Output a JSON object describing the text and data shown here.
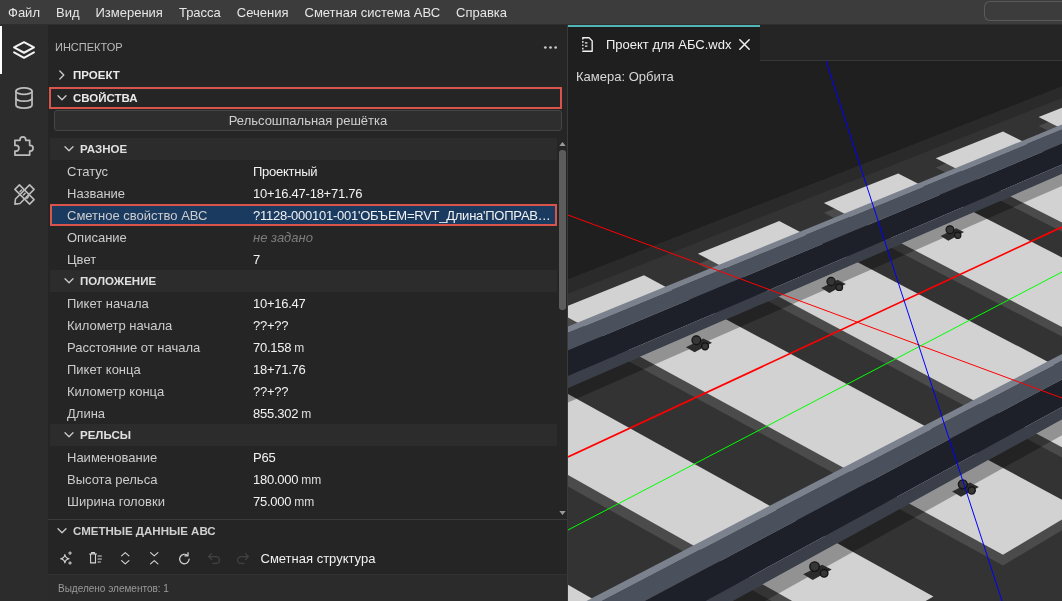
{
  "menu": [
    "Файл",
    "Вид",
    "Измерения",
    "Трасса",
    "Сечения",
    "Сметная система АВС",
    "Справка"
  ],
  "activity_bar": [
    {
      "selected": true
    },
    {
      "selected": false
    },
    {
      "selected": false
    },
    {
      "selected": false
    }
  ],
  "inspector": {
    "title": "ИНСПЕКТОР",
    "sections": [
      {
        "title": "ПРОЕКТ",
        "expanded": false,
        "highlighted": false
      },
      {
        "title": "СВОЙСТВА",
        "expanded": true,
        "highlighted": true,
        "element_type": "Рельсошпальная решётка",
        "property_groups": [
          {
            "title": "РАЗНОЕ",
            "expanded": true,
            "rows": [
              {
                "label": "Статус",
                "value": "Проектный",
                "selected": false,
                "highlighted": false
              },
              {
                "label": "Название",
                "value": "10+16.47-18+71.76",
                "selected": false,
                "highlighted": false
              },
              {
                "label": "Сметное свойство АВС",
                "value": "?1128-000101-001'ОБЪЕМ=RVT_Длина'ПОПРАВ…",
                "selected": true,
                "highlighted": true
              },
              {
                "label": "Описание",
                "placeholder": "не задано",
                "selected": false,
                "highlighted": false
              },
              {
                "label": "Цвет",
                "value": "7",
                "selected": false,
                "highlighted": false
              }
            ]
          },
          {
            "title": "ПОЛОЖЕНИЕ",
            "expanded": true,
            "rows": [
              {
                "label": "Пикет начала",
                "value": "10+16.47",
                "selected": false,
                "highlighted": false
              },
              {
                "label": "Километр начала",
                "value": "??+??",
                "selected": false,
                "highlighted": false
              },
              {
                "label": "Расстояние от начала",
                "value": "70.158",
                "unit": "m",
                "selected": false,
                "highlighted": false
              },
              {
                "label": "Пикет конца",
                "value": "18+71.76",
                "selected": false,
                "highlighted": false
              },
              {
                "label": "Километр конца",
                "value": "??+??",
                "selected": false,
                "highlighted": false
              },
              {
                "label": "Длина",
                "value": "855.302",
                "unit": "m",
                "selected": false,
                "highlighted": false
              }
            ]
          },
          {
            "title": "РЕЛЬСЫ",
            "expanded": true,
            "rows": [
              {
                "label": "Наименование",
                "value": "Р65",
                "selected": false,
                "highlighted": false
              },
              {
                "label": "Высота рельса",
                "value": "180.000",
                "unit": "mm",
                "selected": false,
                "highlighted": false
              },
              {
                "label": "Ширина головки",
                "value": "75.000",
                "unit": "mm",
                "selected": false,
                "highlighted": false
              }
            ]
          }
        ]
      }
    ],
    "estimate_panel": {
      "title": "СМЕТНЫЕ ДАННЫЕ АВС",
      "expanded": true,
      "tools": [
        {
          "disabled": false
        },
        {
          "disabled": false
        },
        {
          "disabled": false
        },
        {
          "disabled": false
        },
        {
          "disabled": false
        },
        {
          "disabled": true
        },
        {
          "disabled": true
        }
      ],
      "structure_title": "Сметная структура"
    },
    "status": "Выделено элементов: 1"
  },
  "editor": {
    "tabs": [
      {
        "label": "Проект для АБС.wdx",
        "selected": true
      }
    ],
    "camera": "Камера: Орбита"
  }
}
